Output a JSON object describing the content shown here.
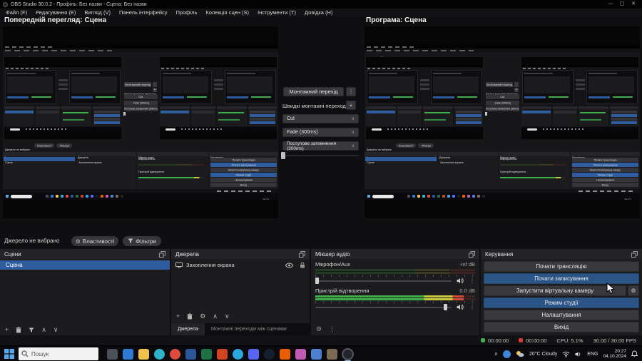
{
  "window": {
    "title": "OBS Studio 30.0.2 - Профіль: Без назви - Сцена: Без назви",
    "menu": [
      "Файл (F)",
      "Редагування (E)",
      "Вигляд (V)",
      "Панель інтерфейсу",
      "Профіль",
      "Колекція сцен (S)",
      "Інструменти (T)",
      "Довідка (H)"
    ]
  },
  "studio": {
    "preview_label": "Попередній перегляд: Сцена",
    "program_label": "Програма: Сцена",
    "transition_button": "Монтажний перехід",
    "quick_transitions_label": "Швидкі монтажні переходи",
    "transitions": [
      "Cut",
      "Fade (300ms)",
      "Поступове затемнення (300ms)"
    ]
  },
  "source_toolbar": {
    "status": "Джерело не вибрано",
    "properties": "Властивості",
    "filters": "Фільтри"
  },
  "scenes": {
    "title": "Сцени",
    "selected": "Сцена"
  },
  "sources": {
    "title": "Джерела",
    "item": "Захоплення екрана",
    "tab_sources": "Джерела",
    "tab_transitions": "Монтажні переходи між сценами"
  },
  "mixer": {
    "title": "Мікшер аудіо",
    "channels": [
      {
        "name": "Мікрофон/Aux",
        "level": "-inf dB",
        "meter_pct": 0,
        "slider_pct": 0
      },
      {
        "name": "Пристрій відтворення",
        "level": "0.0 dB",
        "meter_pct": 93,
        "slider_pct": 97
      }
    ]
  },
  "controls": {
    "title": "Керування",
    "stream": "Почати трансляцію",
    "record": "Почати записування",
    "vcam": "Запустити віртуальну камеру",
    "studio_mode": "Режим студії",
    "settings": "Налаштування",
    "exit": "Вихід"
  },
  "status": {
    "stream_time": "00:00:00",
    "rec_time": "00:00:00",
    "cpu": "CPU: 5.1%",
    "fps": "30.00 / 30.00 FPS"
  },
  "taskbar": {
    "search_placeholder": "Пошук",
    "weather": "20°C Cloudy",
    "lang": "ENG",
    "time": "20:27",
    "date": "04.10.2024",
    "app_icons": [
      {
        "name": "task-view",
        "color": "#4a5059"
      },
      {
        "name": "widgets",
        "color": "#2f7bd4"
      },
      {
        "name": "file-explorer",
        "color": "#f0c24b"
      },
      {
        "name": "edge",
        "color": "#2fb3c9",
        "shape": "circle"
      },
      {
        "name": "chrome",
        "color": "#de4b3c",
        "shape": "circle"
      },
      {
        "name": "word",
        "color": "#2b579a"
      },
      {
        "name": "excel",
        "color": "#1e7145"
      },
      {
        "name": "powerpoint",
        "color": "#d04423"
      },
      {
        "name": "telegram",
        "color": "#29a9e0",
        "shape": "circle"
      },
      {
        "name": "discord",
        "color": "#5865f2"
      },
      {
        "name": "steam",
        "color": "#16202d",
        "shape": "circle"
      },
      {
        "name": "vlc",
        "color": "#e85d00"
      },
      {
        "name": "paint",
        "color": "#c05ab0"
      },
      {
        "name": "photos",
        "color": "#4f7fd0"
      },
      {
        "name": "gimp",
        "color": "#7d6a55"
      },
      {
        "name": "obs-studio",
        "color": "#23232a",
        "shape": "circle",
        "active": true
      }
    ]
  }
}
